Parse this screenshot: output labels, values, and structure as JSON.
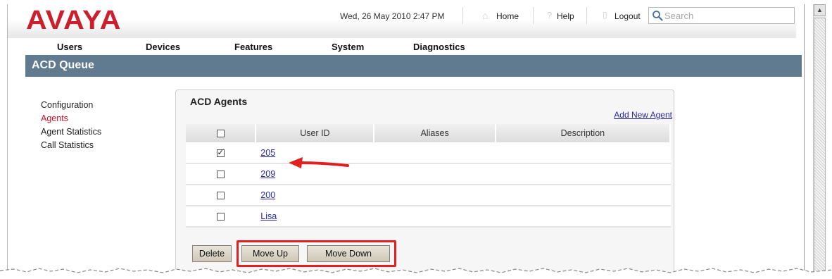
{
  "brand": {
    "logo_text": "AVAYA",
    "logo_color": "#cc1f2e"
  },
  "header": {
    "datetime": "Wed, 26 May 2010 2:47 PM",
    "home_label": "Home",
    "help_label": "Help",
    "logout_label": "Logout",
    "search_placeholder": "Search"
  },
  "nav": {
    "items": [
      "Users",
      "Devices",
      "Features",
      "System",
      "Diagnostics"
    ]
  },
  "page": {
    "title": "ACD Queue",
    "title_bar_color": "#607a8f"
  },
  "sidebar": {
    "items": [
      {
        "label": "Configuration",
        "active": false
      },
      {
        "label": "Agents",
        "active": true
      },
      {
        "label": "Agent Statistics",
        "active": false
      },
      {
        "label": "Call Statistics",
        "active": false
      }
    ],
    "active_color": "#c8102e"
  },
  "panel": {
    "title": "ACD Agents",
    "add_link": "Add New Agent",
    "columns": [
      "",
      "User ID",
      "Aliases",
      "Description"
    ],
    "rows": [
      {
        "checked": true,
        "user_id": "205",
        "aliases": "",
        "description": ""
      },
      {
        "checked": false,
        "user_id": "209",
        "aliases": "",
        "description": ""
      },
      {
        "checked": false,
        "user_id": "200",
        "aliases": "",
        "description": ""
      },
      {
        "checked": false,
        "user_id": "Lisa",
        "aliases": "",
        "description": ""
      }
    ]
  },
  "actions": {
    "delete_label": "Delete",
    "move_up_label": "Move Up",
    "move_down_label": "Move Down"
  },
  "annotations": {
    "highlight_color": "#e22020",
    "arrow_target": "205"
  },
  "icons": {
    "search": "search-icon",
    "home": "home-icon",
    "help": "help-icon",
    "logout": "lock-icon",
    "scroll_up": "chevron-up-icon"
  }
}
